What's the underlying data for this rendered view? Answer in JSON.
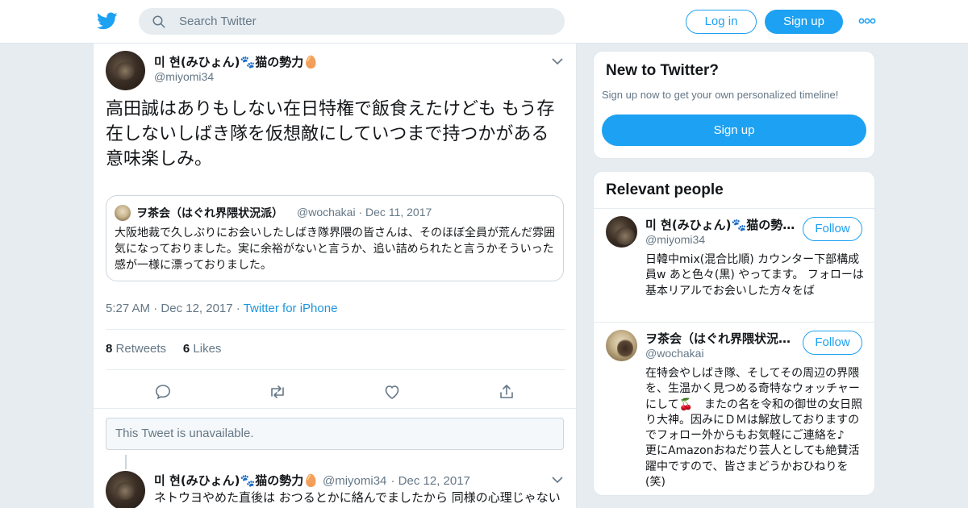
{
  "colors": {
    "accent": "#1da1f2",
    "link": "#1b95e0",
    "muted": "#657786",
    "background": "#e6ecf0"
  },
  "header": {
    "logo_icon": "twitter-bird-icon",
    "search_placeholder": "Search Twitter",
    "login_label": "Log in",
    "signup_label": "Sign up",
    "more_icon": "more-dots-icon"
  },
  "tweet": {
    "name": "미 현(みひょん)🐾猫の勢力🥚",
    "handle": "@miyomi34",
    "text": "高田誠はありもしない在日特権で飯食えたけども もう存在しないしばき隊を仮想敵にしていつまで持つかがある意味楽しみ。",
    "quote": {
      "name": "ヲ茶会（はぐれ界隈状況派）",
      "handle": "@wochakai",
      "date": "Dec 11, 2017",
      "text": "大阪地裁で久しぶりにお会いしたしばき隊界隈の皆さんは、そのほぼ全員が荒んだ雰囲気になっておりました。実に余裕がないと言うか、追い詰められたと言うかそういった感が一様に漂っておりました。"
    },
    "time": "5:27 AM",
    "date": "Dec 12, 2017",
    "source": "Twitter for iPhone",
    "retweets_count": "8",
    "retweets_label": "Retweets",
    "likes_count": "6",
    "likes_label": "Likes"
  },
  "unavailable_text": "This Tweet is unavailable.",
  "reply": {
    "name": "미 현(みひょん)🐾猫の勢力🥚",
    "handle": "@miyomi34",
    "date": "Dec 12, 2017",
    "text": "ネトウヨやめた直後は おつるとかに絡んでましたから 同様の心理じゃない"
  },
  "sidebar": {
    "new_title": "New to Twitter?",
    "new_sub": "Sign up now to get your own personalized timeline!",
    "signup_label": "Sign up",
    "relevant_title": "Relevant people",
    "people": [
      {
        "name": "미 현(みひょん)🐾猫の勢力🥚",
        "handle": "@miyomi34",
        "follow_label": "Follow",
        "bio": "日韓中mix(混合比順) カウンター下部構成員w あと色々(黒) やってます。 フォローは基本リアルでお会いした方々をば"
      },
      {
        "name": "ヲ茶会（はぐれ界隈状況派）",
        "handle": "@wochakai",
        "follow_label": "Follow",
        "bio": "在特会やしばき隊、そしてその周辺の界隈を、生温かく見つめる奇特なウォッチャーにして🍒　またの名を令和の御世の女日照り大神。因みにＤＭは解放しておりますのでフォロー外からもお気軽にご連絡を♪　更にAmazonおねだり芸人としても絶賛活躍中ですので、皆さまどうかおひねりを(笑)"
      }
    ]
  }
}
